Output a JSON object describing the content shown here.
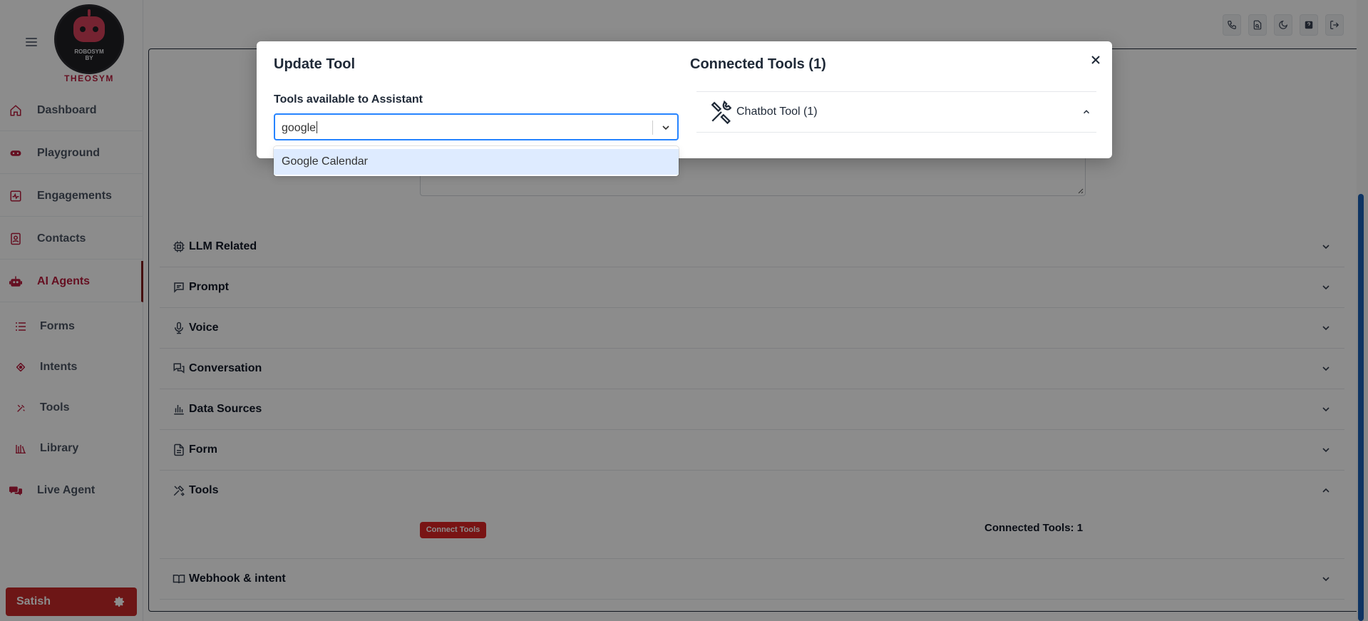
{
  "sidebar": {
    "logo": {
      "line1": "ROBOSYM",
      "line2": "BY",
      "brand": "THEOSYM"
    },
    "nav": [
      {
        "label": "Dashboard",
        "icon": "home-icon"
      },
      {
        "label": "Playground",
        "icon": "gamepad-icon"
      },
      {
        "label": "Engagements",
        "icon": "activity-icon"
      },
      {
        "label": "Contacts",
        "icon": "contact-icon"
      },
      {
        "label": "AI Agents",
        "icon": "robot-icon",
        "active": true
      }
    ],
    "subnav": [
      {
        "label": "Forms",
        "icon": "list-icon"
      },
      {
        "label": "Intents",
        "icon": "intent-icon"
      },
      {
        "label": "Tools",
        "icon": "tools-icon"
      },
      {
        "label": "Library",
        "icon": "library-icon"
      }
    ],
    "live_agent": {
      "label": "Live Agent",
      "icon": "chat-icon"
    },
    "user": {
      "name": "Satish"
    }
  },
  "topbar": {
    "icons": [
      "phone-icon",
      "file-search-icon",
      "moon-icon",
      "help-icon",
      "logout-icon"
    ]
  },
  "sections": [
    {
      "label": "LLM Related",
      "icon": "chip-icon",
      "expanded": false
    },
    {
      "label": "Prompt",
      "icon": "message-icon",
      "expanded": false
    },
    {
      "label": "Voice",
      "icon": "mic-icon",
      "expanded": false
    },
    {
      "label": "Conversation",
      "icon": "conversation-icon",
      "expanded": false
    },
    {
      "label": "Data Sources",
      "icon": "bar-chart-icon",
      "expanded": false
    },
    {
      "label": "Form",
      "icon": "file-icon",
      "expanded": false
    },
    {
      "label": "Tools",
      "icon": "tools-icon",
      "expanded": true
    },
    {
      "label": "Webhook & intent",
      "icon": "book-icon",
      "expanded": false
    }
  ],
  "tools_section": {
    "connect_label": "Connect Tools",
    "connected_label": "Connected Tools: 1"
  },
  "modal": {
    "title": "Update Tool",
    "field_label": "Tools available to Assistant",
    "search_value": "google",
    "options": [
      "Google Calendar"
    ],
    "right_title": "Connected Tools (1)",
    "connected": [
      {
        "label": "Chatbot Tool (1)",
        "expanded": true
      }
    ]
  },
  "colors": {
    "brand": "#c62828",
    "select_focus": "#2684ff",
    "option_highlight": "#deebff",
    "scroll_thumb": "#1a5fb4"
  }
}
